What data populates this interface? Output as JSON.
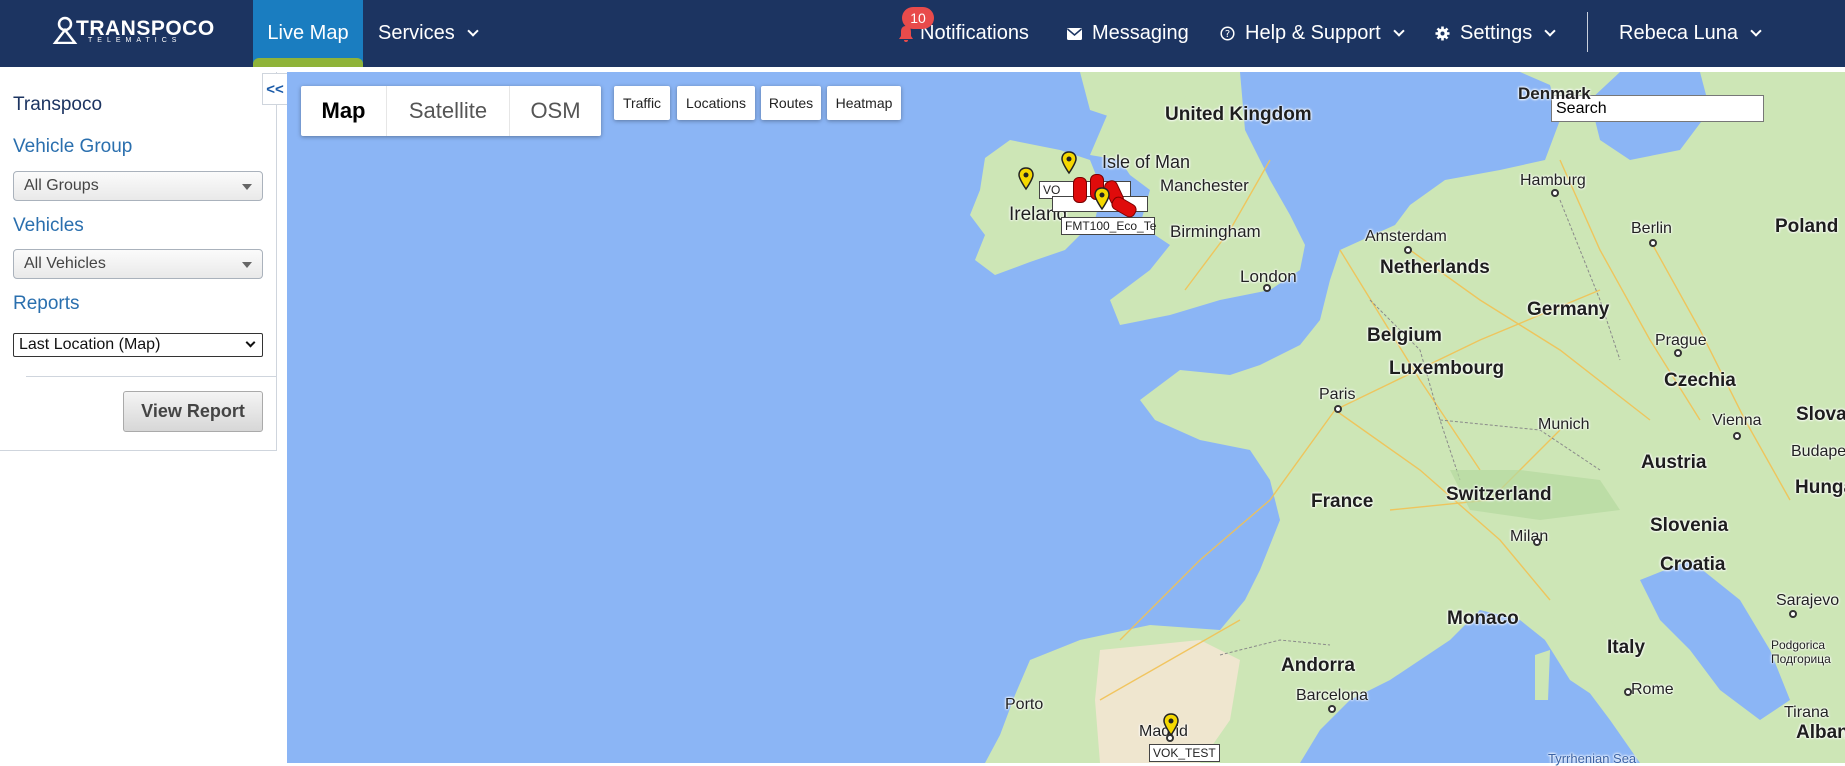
{
  "header": {
    "logo_text": "TRANSPOCO",
    "logo_subtext": "TELEMATICS",
    "nav": [
      {
        "label": "Live Map"
      },
      {
        "label": "Services"
      },
      {
        "label": "Notifications",
        "badge": "10"
      },
      {
        "label": "Messaging"
      },
      {
        "label": "Help & Support"
      },
      {
        "label": "Settings"
      },
      {
        "label": "Rebeca Luna"
      }
    ]
  },
  "sidebar": {
    "collapse_label": "<<",
    "company": "Transpoco",
    "vehicle_group_label": "Vehicle Group",
    "vehicle_group_value": "All Groups",
    "vehicles_label": "Vehicles",
    "vehicles_value": "All Vehicles",
    "reports_label": "Reports",
    "report_value": "Last Location (Map)",
    "view_report_button": "View Report"
  },
  "map": {
    "type_tabs": [
      {
        "label": "Map",
        "active": true
      },
      {
        "label": "Satellite",
        "active": false
      },
      {
        "label": "OSM",
        "active": false
      }
    ],
    "overlay_buttons": [
      "Traffic",
      "Locations",
      "Routes",
      "Heatmap"
    ],
    "search_placeholder": "Search",
    "places": {
      "denmark": "Denmark",
      "united_kingdom": "United Kingdom",
      "isle_of_man": "Isle of Man",
      "manchester": "Manchester",
      "ireland": "Ireland",
      "birmingham": "Birmingham",
      "london": "London",
      "hamburg": "Hamburg",
      "berlin": "Berlin",
      "poland": "Poland",
      "amsterdam": "Amsterdam",
      "netherlands": "Netherlands",
      "germany": "Germany",
      "belgium": "Belgium",
      "luxembourg": "Luxembourg",
      "prague": "Prague",
      "czechia": "Czechia",
      "paris": "Paris",
      "munich": "Munich",
      "vienna": "Vienna",
      "slovak": "Slovak",
      "budapest": "Budapes",
      "austria": "Austria",
      "hungary": "Hunga",
      "france": "France",
      "switzerland": "Switzerland",
      "milan": "Milan",
      "slovenia": "Slovenia",
      "croatia": "Croatia",
      "sarajevo": "Sarajevo",
      "monaco": "Monaco",
      "italy": "Italy",
      "podgorica": "Podgorica",
      "podgorica_cyr": "Подгорица",
      "andorra": "Andorra",
      "barcelona": "Barcelona",
      "porto": "Porto",
      "rome": "Rome",
      "tirana": "Tirana",
      "albania": "Albani",
      "madrid": "Madrid",
      "tyrrhenian_sea": "Tyrrhenian Sea"
    },
    "vehicle_labels": {
      "ireland_cluster_1": "VO",
      "ireland_cluster_2": "FMT100_Eco_Te",
      "madrid": "VOK_TEST"
    }
  }
}
